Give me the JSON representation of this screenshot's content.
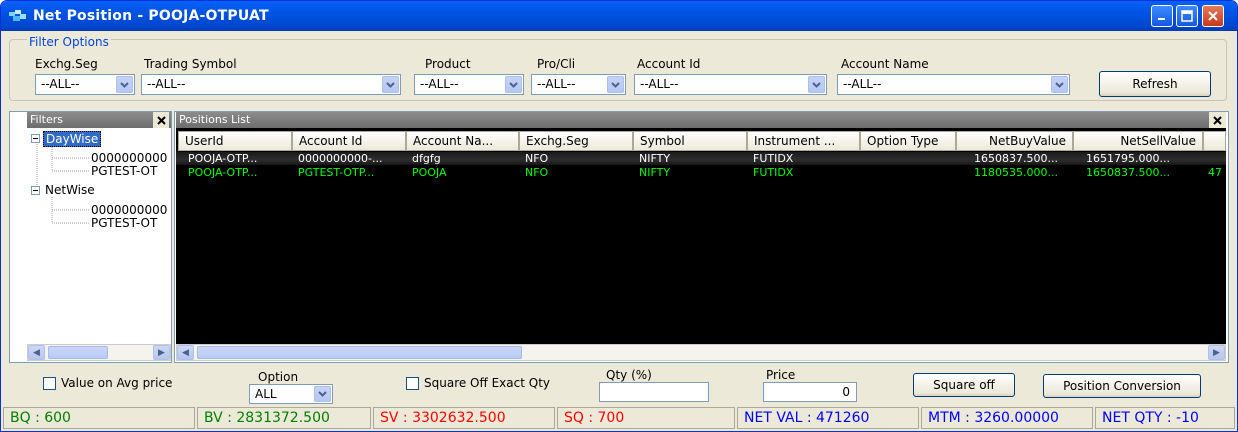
{
  "window": {
    "title": "Net Position - POOJA-OTPUAT"
  },
  "filter_options": {
    "legend": "Filter Options",
    "fields": [
      {
        "label": "Exchg.Seg",
        "value": "--ALL--"
      },
      {
        "label": "Trading Symbol",
        "value": "--ALL--"
      },
      {
        "label": "Product",
        "value": "--ALL--"
      },
      {
        "label": "Pro/Cli",
        "value": "--ALL--"
      },
      {
        "label": "Account Id",
        "value": "--ALL--"
      },
      {
        "label": "Account Name",
        "value": "--ALL--"
      }
    ],
    "refresh_label": "Refresh"
  },
  "filters_panel": {
    "title": "Filters",
    "tree": [
      {
        "label": "DayWise",
        "selected": true,
        "children": [
          "0000000000",
          "PGTEST-OT"
        ]
      },
      {
        "label": "NetWise",
        "selected": false,
        "children": [
          "0000000000",
          "PGTEST-OT"
        ]
      }
    ]
  },
  "positions": {
    "title": "Positions List",
    "columns": [
      "UserId",
      "Account Id",
      "Account Na...",
      "Exchg.Seg",
      "Symbol",
      "Instrument ...",
      "Option Type",
      "NetBuyValue",
      "NetSellValue"
    ],
    "rows": [
      {
        "cells": [
          "POOJA-OTP...",
          "0000000000-...",
          "dfgfg",
          "NFO",
          "NIFTY",
          "FUTIDX",
          "",
          "1650837.500...",
          "1651795.000...",
          ""
        ],
        "color": "#ffffff"
      },
      {
        "cells": [
          "POOJA-OTP...",
          "PGTEST-OTP...",
          "POOJA",
          "NFO",
          "NIFTY",
          "FUTIDX",
          "",
          "1180535.000...",
          "1650837.500...",
          "47"
        ],
        "color": "#00ff00"
      }
    ]
  },
  "bottom": {
    "value_on_avg_label": "Value on Avg  price",
    "option_label": "Option",
    "option_value": "ALL",
    "square_off_exact_label": "Square Off Exact Qty",
    "qty_label": "Qty (%)",
    "qty_value": "",
    "price_label": "Price",
    "price_value": "0",
    "square_off_label": "Square off",
    "position_conversion_label": "Position Conversion"
  },
  "status": {
    "bq": "BQ : 600",
    "bv": "BV : 2831372.500",
    "sv": "SV : 3302632.500",
    "sq": "SQ : 700",
    "net_val": "NET VAL : 471260",
    "mtm": "MTM : 3260.00000",
    "net_qty": "NET QTY : -10"
  },
  "colors": {
    "buy": "#008000",
    "sell": "#ff0000",
    "net": "#0000ff",
    "title_bar": "#0054e3"
  }
}
